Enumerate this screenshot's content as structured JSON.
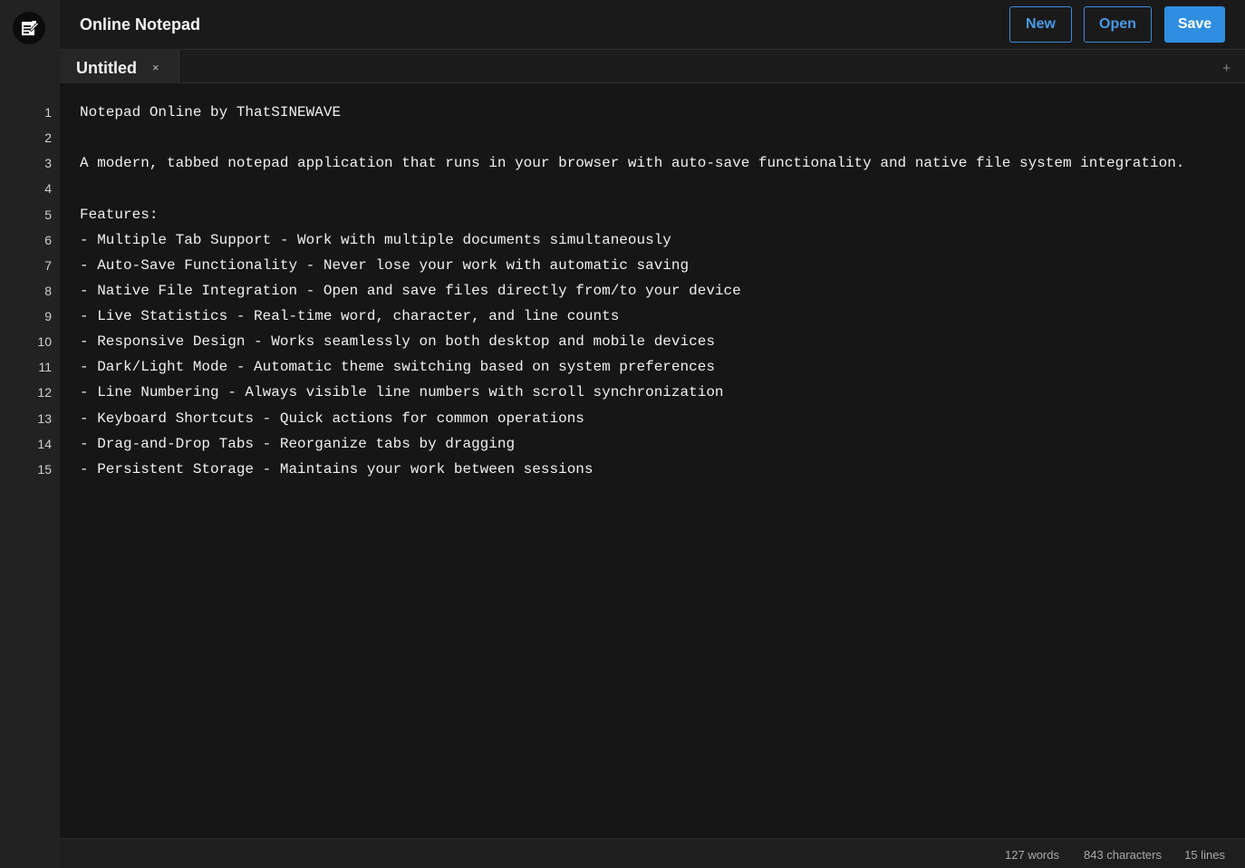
{
  "header": {
    "title": "Online Notepad",
    "logo_icon": "notepad-icon",
    "buttons": {
      "new": "New",
      "open": "Open",
      "save": "Save"
    }
  },
  "tabs": [
    {
      "label": "Untitled",
      "close": "×",
      "active": true
    }
  ],
  "tab_add": "+",
  "editor": {
    "line_numbers": [
      "1",
      "2",
      "3",
      "4",
      "5",
      "6",
      "7",
      "8",
      "9",
      "10",
      "11",
      "12",
      "13",
      "14",
      "15"
    ],
    "lines": [
      "Notepad Online by ThatSINEWAVE",
      "",
      "A modern, tabbed notepad application that runs in your browser with auto-save functionality and native file system integration.",
      "",
      "Features:",
      "- Multiple Tab Support - Work with multiple documents simultaneously",
      "- Auto-Save Functionality - Never lose your work with automatic saving",
      "- Native File Integration - Open and save files directly from/to your device",
      "- Live Statistics - Real-time word, character, and line counts",
      "- Responsive Design - Works seamlessly on both desktop and mobile devices",
      "- Dark/Light Mode - Automatic theme switching based on system preferences",
      "- Line Numbering - Always visible line numbers with scroll synchronization",
      "- Keyboard Shortcuts - Quick actions for common operations",
      "- Drag-and-Drop Tabs - Reorganize tabs by dragging",
      "- Persistent Storage - Maintains your work between sessions"
    ]
  },
  "status": {
    "words": "127 words",
    "characters": "843 characters",
    "lines": "15 lines"
  },
  "colors": {
    "accent": "#2f8ee0",
    "background": "#161616",
    "header": "#1a1a1a"
  }
}
